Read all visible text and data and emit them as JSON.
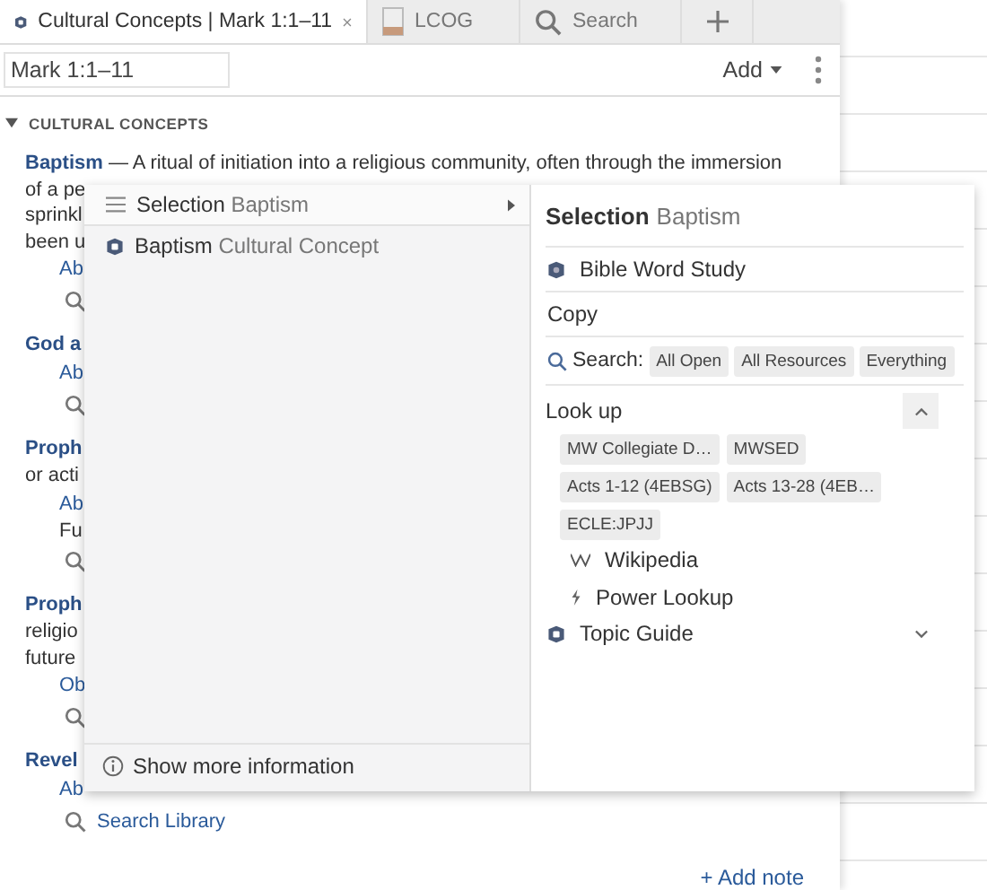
{
  "tabs": [
    {
      "kind": "concepts",
      "label": "Cultural Concepts | Mark 1:1–11",
      "selected": true,
      "closable": true
    },
    {
      "kind": "book",
      "label": "LCOG",
      "selected": false,
      "closable": false
    },
    {
      "kind": "search",
      "label": "Search",
      "selected": false,
      "closable": false
    }
  ],
  "toolbar": {
    "reference": "Mark 1:1–11",
    "add": "Add"
  },
  "section": {
    "title": "CULTURAL CONCEPTS",
    "expanded": true
  },
  "lines": [
    {
      "kind": "term",
      "term": "Baptism",
      "text": "— A ritual of initiation into a religious community, often through the immersion"
    },
    {
      "kind": "text",
      "text": "of a pe"
    },
    {
      "kind": "text",
      "text": "sprinkl"
    },
    {
      "kind": "text",
      "text": "been u"
    },
    {
      "kind": "link",
      "text": "Ab"
    },
    {
      "kind": "search"
    },
    {
      "kind": "term",
      "term": "God a"
    },
    {
      "kind": "link",
      "text": "Ab"
    },
    {
      "kind": "search"
    },
    {
      "kind": "term",
      "term": "Proph"
    },
    {
      "kind": "text",
      "text": "or acti"
    },
    {
      "kind": "link",
      "text": "Ab"
    },
    {
      "kind": "note",
      "text": "Fu"
    },
    {
      "kind": "search"
    },
    {
      "kind": "term",
      "term": "Proph"
    },
    {
      "kind": "text",
      "text": "religio"
    },
    {
      "kind": "text",
      "text": "future"
    },
    {
      "kind": "link",
      "text": "Ob"
    },
    {
      "kind": "search"
    },
    {
      "kind": "term",
      "term": "Revel"
    },
    {
      "kind": "link",
      "text": "Ab"
    },
    {
      "kind": "search",
      "text": "Search Library"
    }
  ],
  "add_note": "+ Add note",
  "menu": {
    "items": [
      {
        "kind": "selection",
        "label": "Selection",
        "detail": "Baptism",
        "selected": true
      },
      {
        "kind": "concept",
        "label": "Baptism",
        "detail": "Cultural Concept",
        "selected": false
      }
    ],
    "footer": "Show more information"
  },
  "submenu": {
    "title": "Selection",
    "subtitle": "Baptism",
    "word_study": "Bible Word Study",
    "copy": "Copy",
    "search": {
      "label": "Search:",
      "scopes": [
        "All Open",
        "All Resources",
        "Everything"
      ]
    },
    "lookup": {
      "label": "Look up",
      "expanded": true,
      "resources": [
        "MW Collegiate D…",
        "MWSED",
        "Acts 1-12 (4EBSG)",
        "Acts 13-28 (4EB…",
        "ECLE:JPJJ"
      ],
      "links": [
        {
          "kind": "wikipedia",
          "label": "Wikipedia"
        },
        {
          "kind": "power",
          "label": "Power Lookup"
        }
      ]
    },
    "topic_guide": {
      "label": "Topic Guide",
      "expanded": false
    }
  }
}
